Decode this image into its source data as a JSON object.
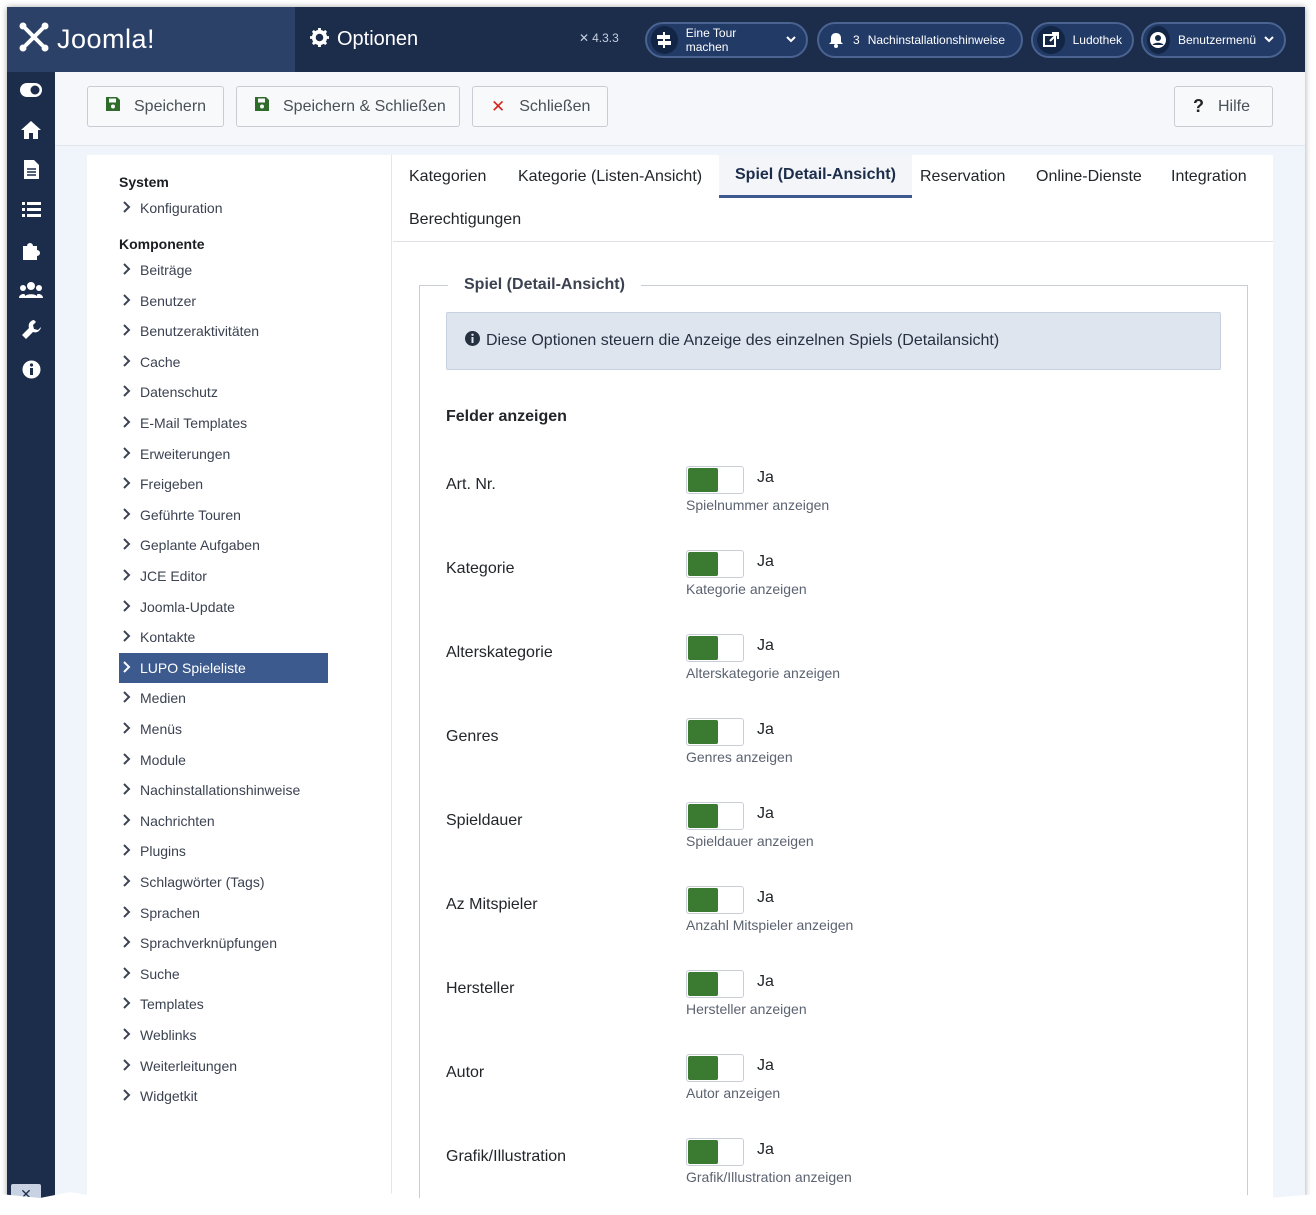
{
  "header": {
    "brand": "Joomla!",
    "page_title": "Optionen",
    "version": "4.3.3",
    "tour_label": "Eine Tour machen",
    "notifications_count": "3",
    "post_install_label": "Nachinstallationshinweise",
    "site_label": "Ludothek",
    "user_menu_label": "Benutzermenü"
  },
  "toolbar": {
    "save_label": "Speichern",
    "save_close_label": "Speichern & Schließen",
    "close_label": "Schließen",
    "help_label": "Hilfe"
  },
  "sidebar": {
    "system_heading": "System",
    "system_items": [
      "Konfiguration"
    ],
    "component_heading": "Komponente",
    "component_items": [
      "Beiträge",
      "Benutzer",
      "Benutzeraktivitäten",
      "Cache",
      "Datenschutz",
      "E-Mail Templates",
      "Erweiterungen",
      "Freigeben",
      "Geführte Touren",
      "Geplante Aufgaben",
      "JCE Editor",
      "Joomla-Update",
      "Kontakte",
      "LUPO Spieleliste",
      "Medien",
      "Menüs",
      "Module",
      "Nachinstallationshinweise",
      "Nachrichten",
      "Plugins",
      "Schlagwörter (Tags)",
      "Sprachen",
      "Sprachverknüpfungen",
      "Suche",
      "Templates",
      "Weblinks",
      "Weiterleitungen",
      "Widgetkit"
    ],
    "active_item": "LUPO Spieleliste"
  },
  "tabs": [
    "Kategorien",
    "Kategorie (Listen-Ansicht)",
    "Spiel (Detail-Ansicht)",
    "Reservation",
    "Online-Dienste",
    "Integration",
    "Berechtigungen"
  ],
  "active_tab": "Spiel (Detail-Ansicht)",
  "panel": {
    "legend": "Spiel (Detail-Ansicht)",
    "info": "Diese Optionen steuern die Anzeige des einzelnen Spiels (Detailansicht)",
    "section_heading": "Felder anzeigen",
    "fields": [
      {
        "label": "Art. Nr.",
        "state": "Ja",
        "desc": "Spielnummer anzeigen"
      },
      {
        "label": "Kategorie",
        "state": "Ja",
        "desc": "Kategorie anzeigen"
      },
      {
        "label": "Alterskategorie",
        "state": "Ja",
        "desc": "Alterskategorie anzeigen"
      },
      {
        "label": "Genres",
        "state": "Ja",
        "desc": "Genres anzeigen"
      },
      {
        "label": "Spieldauer",
        "state": "Ja",
        "desc": "Spieldauer anzeigen"
      },
      {
        "label": "Az Mitspieler",
        "state": "Ja",
        "desc": "Anzahl Mitspieler anzeigen"
      },
      {
        "label": "Hersteller",
        "state": "Ja",
        "desc": "Hersteller anzeigen"
      },
      {
        "label": "Autor",
        "state": "Ja",
        "desc": "Autor anzeigen"
      },
      {
        "label": "Grafik/Illustration",
        "state": "Ja",
        "desc": "Grafik/Illustration anzeigen"
      }
    ]
  },
  "colors": {
    "header_bg": "#1c2d4b",
    "accent": "#3d5a8f",
    "switch_on": "#3a7a31",
    "close_icon": "#d4261d"
  }
}
